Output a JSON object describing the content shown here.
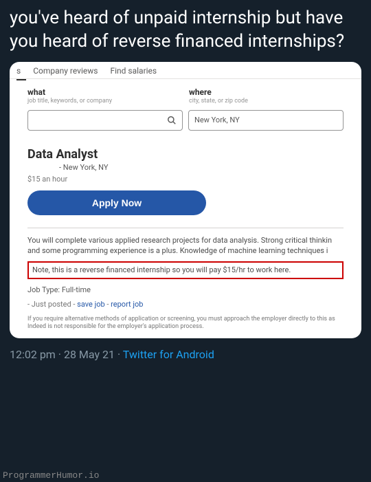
{
  "tweet": {
    "text": "you've heard of unpaid internship but have you heard of reverse financed internships?",
    "time": "12:02 pm",
    "date": "28 May 21",
    "source": "Twitter for Android",
    "sep": " · "
  },
  "tabs": {
    "partial": "s",
    "reviews": "Company reviews",
    "salaries": "Find salaries"
  },
  "search": {
    "what_label": "what",
    "what_hint": "job title, keywords, or company",
    "where_label": "where",
    "where_hint": "city, state, or zip code",
    "where_value": "New York, NY"
  },
  "job": {
    "title": "Data Analyst",
    "location_prefix": "- ",
    "location": "New York, NY",
    "pay": "$15 an hour",
    "apply": "Apply Now",
    "description": "You will complete various applied research projects for data analysis. Strong critical thinkin and some programming experience is a plus. Knowledge of machine learning techniques i",
    "note": "Note, this is a reverse financed internship so you will pay $15/hr to work here.",
    "type_label": "Job Type: Full-time",
    "posted_prefix": "- Just posted - ",
    "save_link": "save job",
    "link_sep": " - ",
    "report_link": "report job",
    "disclaimer": "If you require alternative methods of application or screening, you must approach the employer directly to this as Indeed is not responsible for the employer's application process."
  },
  "watermark": "ProgrammerHumor.io"
}
